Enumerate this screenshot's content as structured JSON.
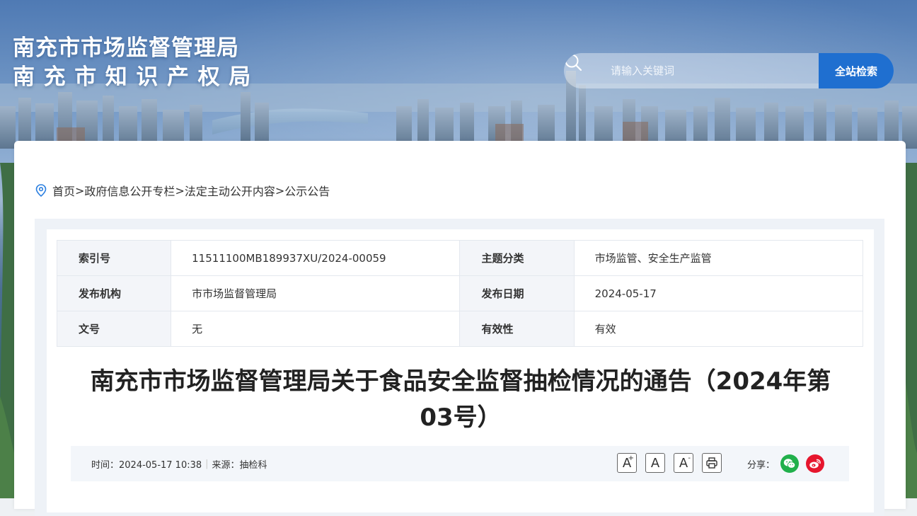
{
  "header": {
    "title_line1": "南充市市场监督管理局",
    "title_line2": "南充市知识产权局",
    "search_placeholder": "请输入关键词",
    "search_button": "全站检索"
  },
  "breadcrumb": {
    "items": [
      "首页",
      "政府信息公开专栏",
      "法定主动公开内容",
      "公示公告"
    ],
    "separator": ">"
  },
  "meta": {
    "index_label": "索引号",
    "index_value": "11511100MB189937XU/2024-00059",
    "topic_label": "主题分类",
    "topic_value": "市场监管、安全生产监管",
    "publisher_label": "发布机构",
    "publisher_value": "市市场监督管理局",
    "date_label": "发布日期",
    "date_value": "2024-05-17",
    "docno_label": "文号",
    "docno_value": "无",
    "validity_label": "有效性",
    "validity_value": "有效"
  },
  "article": {
    "title_line1": "南充市市场监督管理局关于食品安全监督抽检情况的通告（2024年第",
    "title_line2": "03号）",
    "time_text": "时间：2024-05-17 10:38",
    "divider": "|",
    "source_text": "来源：抽检科"
  },
  "toolbar": {
    "font_large": "A",
    "font_large_sup": "+",
    "font_normal": "A",
    "font_small": "A",
    "font_small_sup": "-",
    "share_label": "分享："
  },
  "colors": {
    "accent": "#1f6fd0",
    "wechat": "#21b04b",
    "weibo": "#e6162d",
    "pin": "#2b7fe0"
  }
}
